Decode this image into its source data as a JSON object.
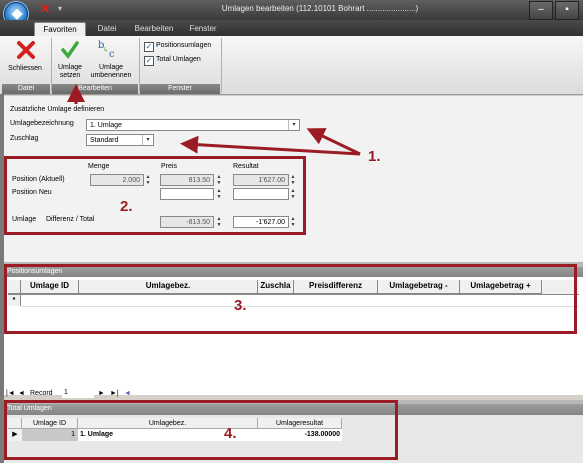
{
  "window": {
    "title": "Umlagen bearbeiten (112.10101 Bohrart ......................)",
    "minimize": "‒",
    "maximize": "▪"
  },
  "tabs": [
    {
      "label": "Favoriten",
      "active": true
    },
    {
      "label": "Datei"
    },
    {
      "label": "Bearbeiten"
    },
    {
      "label": "Fenster"
    }
  ],
  "ribbon": {
    "groups": {
      "datei": "Datei",
      "bearbeiten": "Bearbeiten",
      "fenster": "Fenster"
    },
    "schliessen": "Schliessen",
    "umlage_setzen": "Umlage\nsetzen",
    "umlage_umbenennen": "Umlage\numbenennen",
    "chk_positionsumlagen": "Positionsumlagen",
    "chk_total_umlagen": "Total Umlagen"
  },
  "form": {
    "section_title": "Zusätzliche Umlage definieren",
    "umlagebezeichnung_label": "Umlagebezeichnung",
    "umlagebezeichnung_value": "1. Umlage",
    "zuschlag_label": "Zuschlag",
    "zuschlag_value": "Standard",
    "col_menge": "Menge",
    "col_preis": "Preis",
    "col_resultat": "Resultat",
    "row_position_aktuell": "Position (Aktuell)",
    "row_position_neu": "Position Neu",
    "row_umlage": "Umlage",
    "row_differenz_total": "Differenz / Total",
    "menge_aktuell": "2.000",
    "preis_aktuell": "813.50",
    "resultat_aktuell": "1'627.00",
    "differenz": "-813.50",
    "total": "-1'627.00"
  },
  "annotations": {
    "n1": "1.",
    "n2": "2.",
    "n3": "3.",
    "n4": "4."
  },
  "positionsumlagen": {
    "title": "Positionsumlagen",
    "columns": [
      "Umlage ID",
      "Umlagebez.",
      "Zuschla",
      "Preisdifferenz",
      "Umlagebetrag -",
      "Umlagebetrag +"
    ],
    "new_row_marker": "*"
  },
  "navigator": {
    "label": "Record",
    "value": "1",
    "first": "|◄",
    "prev": "◄",
    "next": "►",
    "last": "►|",
    "new": "◄"
  },
  "total_umlagen": {
    "title": "Total Umlagen",
    "columns": [
      "Umlage ID",
      "Umlagebez.",
      "Umlageresultat"
    ],
    "row": {
      "id": "1",
      "bez": "1. Umlage",
      "resultat": "-138.00000"
    },
    "row_marker": "▶"
  },
  "colors": {
    "annotation": "#9b1c24",
    "accent": "#2a7fd0"
  }
}
